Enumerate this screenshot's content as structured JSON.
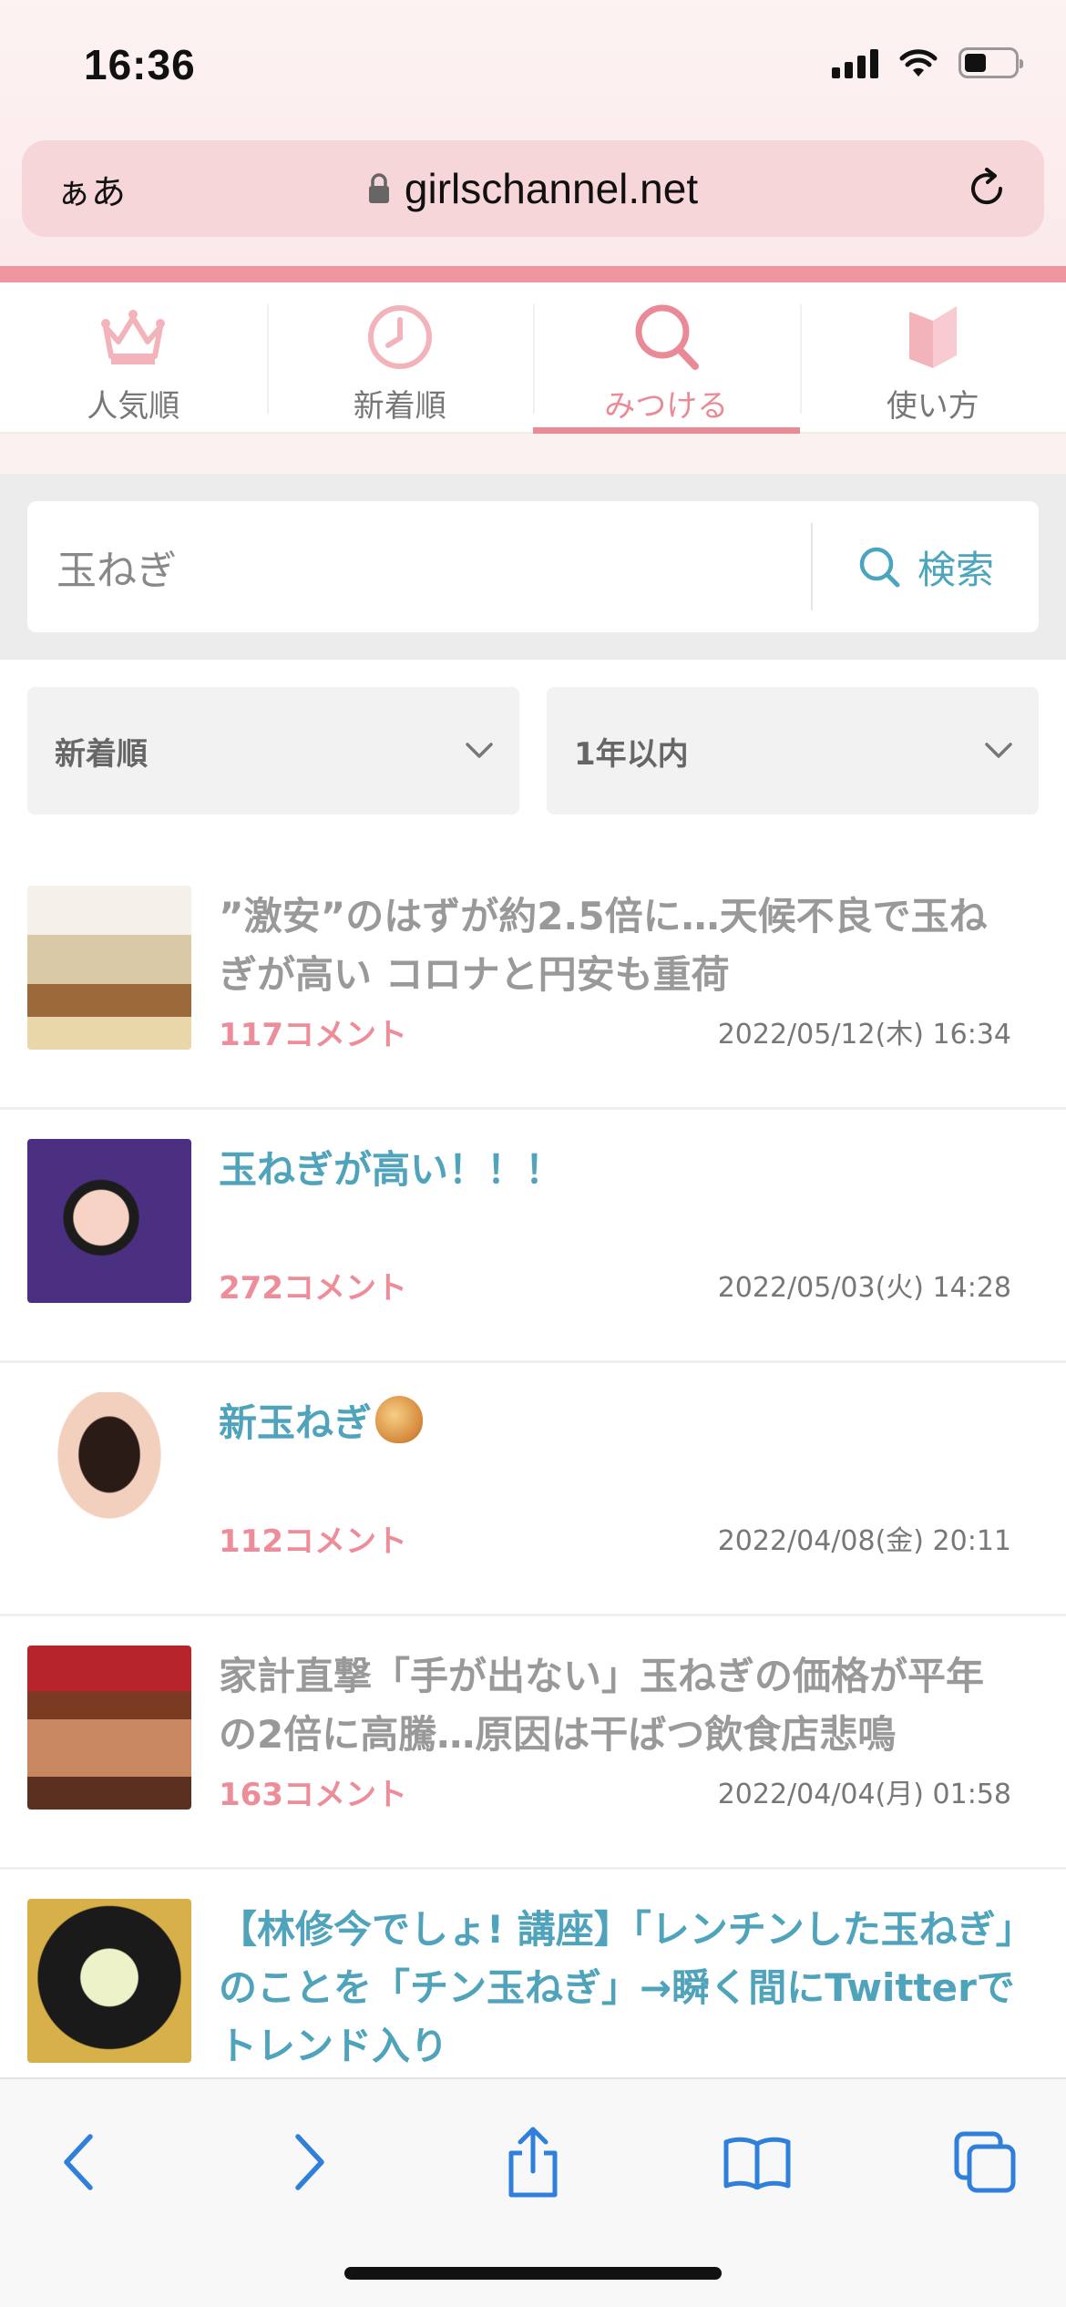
{
  "status_bar": {
    "time": "16:36"
  },
  "browser": {
    "text_size_label": "ぁあ",
    "url": "girlschannel.net"
  },
  "nav_tabs": [
    {
      "label": "人気順",
      "icon": "crown-icon"
    },
    {
      "label": "新着順",
      "icon": "clock-icon"
    },
    {
      "label": "みつける",
      "icon": "search-icon",
      "active": true
    },
    {
      "label": "使い方",
      "icon": "book-icon"
    }
  ],
  "search": {
    "value": "玉ねぎ",
    "button_label": "検索"
  },
  "filters": {
    "sort": "新着順",
    "period": "1年以内"
  },
  "topics": [
    {
      "title": "”激安”のはずが約2.5倍に…天候不良で玉ねぎが高い コロナと円安も重荷",
      "comments": "117コメント",
      "date": "2022/05/12(木) 16:34",
      "visited": true
    },
    {
      "title": "玉ねぎが高い！！！",
      "comments": "272コメント",
      "date": "2022/05/03(火) 14:28",
      "visited": false
    },
    {
      "title": "新玉ねぎ",
      "emoji": "onion-emoji",
      "comments": "112コメント",
      "date": "2022/04/08(金) 20:11",
      "visited": false
    },
    {
      "title": "家計直撃「手が出ない」玉ねぎの価格が平年の2倍に高騰…原因は干ばつ飲食店悲鳴",
      "comments": "163コメント",
      "date": "2022/04/04(月) 01:58",
      "visited": true
    },
    {
      "title": "【林修今でしょ! 講座】「レンチンした玉ねぎ」のことを「チン玉ねぎ」→瞬く間にTwitterでトレンド入り",
      "visited": false
    }
  ],
  "colors": {
    "accent_pink": "#ea8a97",
    "link_blue": "#4fa3bb",
    "visited_gray": "#999999"
  }
}
